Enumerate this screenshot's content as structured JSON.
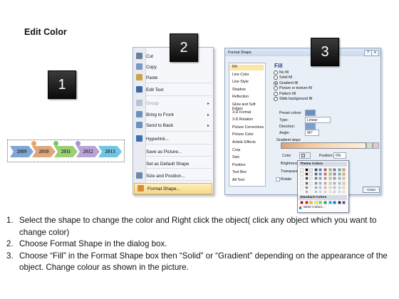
{
  "title": "Edit Color",
  "badges": [
    "1",
    "2",
    "3"
  ],
  "timeline": {
    "years": [
      "2009",
      "2010",
      "2011",
      "2012",
      "2013"
    ],
    "arrow_colors": [
      "#7fa6d6",
      "#e0a77d",
      "#9bcf74",
      "#b9a3d6",
      "#6ec6e3"
    ],
    "dot_colors": [
      "#f4a05a",
      "#7cc46a",
      "#b08ed1"
    ]
  },
  "context_menu": {
    "items": [
      {
        "label": "Cut",
        "icon": "scissors-icon",
        "icon_color": "#6b7f99"
      },
      {
        "label": "Copy",
        "icon": "copy-icon",
        "icon_color": "#7b98c4"
      },
      {
        "label": "Paste",
        "icon": "paste-icon",
        "icon_color": "#c9a24a"
      },
      {
        "label": "Edit Text",
        "icon": "edit-text-icon",
        "icon_color": "#3d6aa6"
      },
      {
        "label": "Group",
        "icon": "group-icon",
        "icon_color": "#b8c4d6",
        "disabled": true,
        "submenu": true
      },
      {
        "label": "Bring to Front",
        "icon": "bring-front-icon",
        "icon_color": "#6d8fbc",
        "submenu": true
      },
      {
        "label": "Send to Back",
        "icon": "send-back-icon",
        "icon_color": "#6d8fbc",
        "submenu": true
      },
      {
        "label": "Hyperlink...",
        "icon": "hyperlink-icon",
        "icon_color": "#3e6fb0"
      },
      {
        "label": "Save as Picture...",
        "icon": "",
        "icon_color": ""
      },
      {
        "label": "Set as Default Shape",
        "icon": "",
        "icon_color": ""
      },
      {
        "label": "Size and Position...",
        "icon": "size-position-icon",
        "icon_color": "#6f87a8"
      },
      {
        "label": "Format Shape...",
        "icon": "format-shape-icon",
        "icon_color": "#d88b3c",
        "highlighted": true
      }
    ]
  },
  "format_dialog": {
    "title": "Format Shape",
    "categories": [
      "Fill",
      "Line Color",
      "Line Style",
      "Shadow",
      "Reflection",
      "Glow and Soft Edges",
      "3-D Format",
      "3-D Rotation",
      "Picture Corrections",
      "Picture Color",
      "Artistic Effects",
      "Crop",
      "Size",
      "Position",
      "Text Box",
      "Alt Text"
    ],
    "selected_category": "Fill",
    "fill_heading": "Fill",
    "fill_options": [
      "No fill",
      "Solid fill",
      "Gradient fill",
      "Picture or texture fill",
      "Pattern fill",
      "Slide background fill"
    ],
    "selected_fill": "Gradient fill",
    "preset_colors_label": "Preset colors:",
    "type_label": "Type:",
    "type_value": "Linear",
    "direction_label": "Direction:",
    "angle_label": "Angle:",
    "angle_value": "90°",
    "gradient_stops_label": "Gradient stops",
    "color_label": "Color",
    "position_label": "Position:",
    "position_value": "0%",
    "brightness_label": "Brightness",
    "transparency_label": "Transparen",
    "rotate_label": "Rotate",
    "close_label": "Close",
    "palette": {
      "theme_colors_label": "Theme Colors",
      "standard_colors_label": "Standard Colors",
      "more_colors_label": "More Colors...",
      "theme_top_row": [
        "#ffffff",
        "#000000",
        "#eeece1",
        "#1f497d",
        "#4f81bd",
        "#c0504d",
        "#9bbb59",
        "#8064a2",
        "#4bacc6",
        "#f79646"
      ],
      "standard_row": [
        "#c00000",
        "#ff0000",
        "#ffc000",
        "#ffff00",
        "#92d050",
        "#00b050",
        "#00b0f0",
        "#0070c0",
        "#002060",
        "#7030a0"
      ]
    }
  },
  "instructions": [
    {
      "num": "1.",
      "text": "Select the shape to change the color and Right click the object( click any object which you want to change color)"
    },
    {
      "num": "2.",
      "text": "Choose Format Shape in the dialog box."
    },
    {
      "num": "3.",
      "text": "Choose “Fill” in the Format Shape box then “Solid” or “Gradient” depending on the appearance of the object. Change colour as shown in the picture."
    }
  ]
}
